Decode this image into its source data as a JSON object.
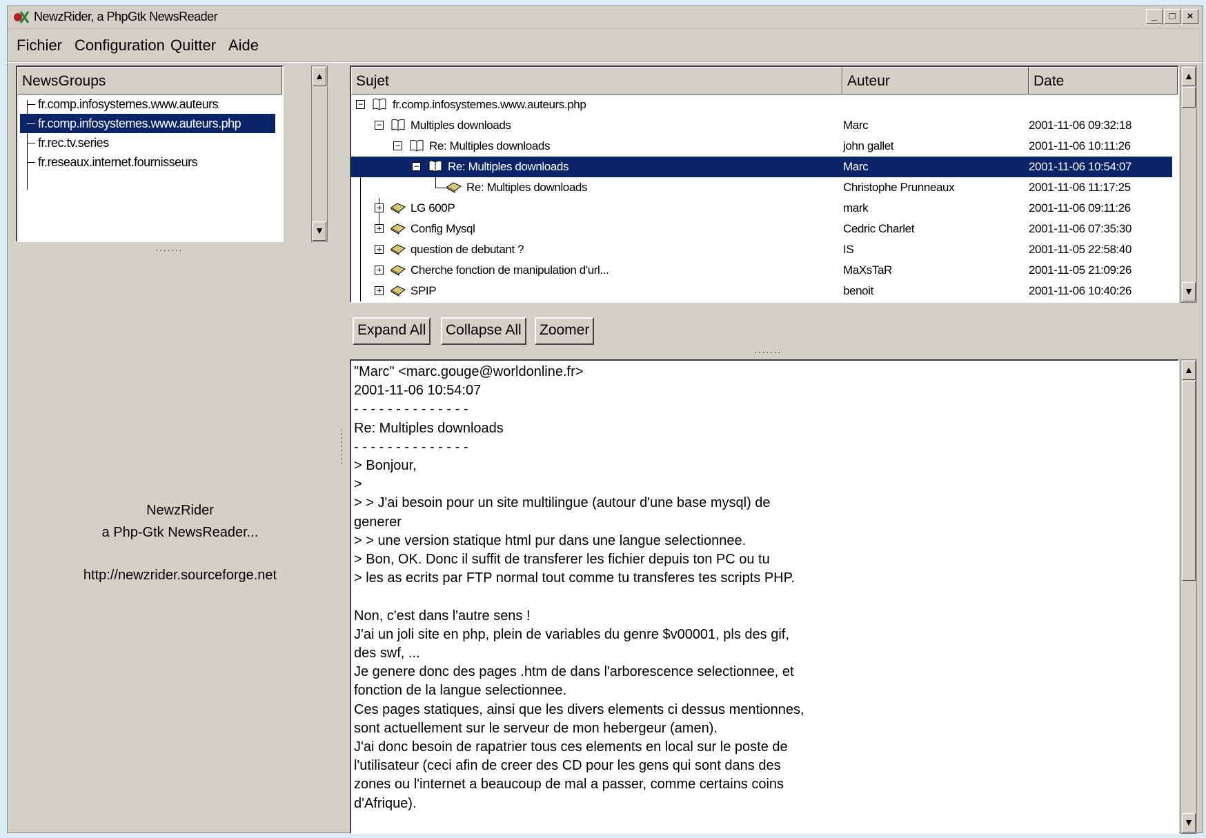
{
  "window": {
    "title": "NewzRider, a PhpGtk NewsReader",
    "minimize": "_",
    "maximize": "□",
    "close": "×"
  },
  "menu": [
    "Fichier",
    "Configuration",
    "Quitter",
    "Aide"
  ],
  "newsgroups": {
    "header": "NewsGroups",
    "items": [
      {
        "label": "fr.comp.infosystemes.www.auteurs",
        "selected": false
      },
      {
        "label": "fr.comp.infosystemes.www.auteurs.php",
        "selected": true
      },
      {
        "label": "fr.rec.tv.series",
        "selected": false
      },
      {
        "label": "fr.reseaux.internet.fournisseurs",
        "selected": false
      }
    ]
  },
  "about": {
    "line1": "NewzRider",
    "line2": "a Php-Gtk NewsReader...",
    "line3": "http://newzrider.sourceforge.net"
  },
  "threads": {
    "headers": {
      "subject": "Sujet",
      "author": "Auteur",
      "date": "Date"
    },
    "rows": [
      {
        "subject": "fr.comp.infosystemes.www.auteurs.php",
        "author": "",
        "date": "",
        "level": 0,
        "expander": "−",
        "icon": "book-icon",
        "selected": false
      },
      {
        "subject": "Multiples downloads",
        "author": "Marc",
        "date": "2001-11-06 09:32:18",
        "level": 1,
        "expander": "−",
        "icon": "book-icon",
        "selected": false
      },
      {
        "subject": "Re: Multiples downloads",
        "author": "john gallet",
        "date": "2001-11-06 10:11:26",
        "level": 2,
        "expander": "−",
        "icon": "book-icon",
        "selected": false
      },
      {
        "subject": "Re: Multiples downloads",
        "author": "Marc",
        "date": "2001-11-06 10:54:07",
        "level": 3,
        "expander": "−",
        "icon": "book-icon",
        "selected": true
      },
      {
        "subject": "Re: Multiples downloads",
        "author": "Christophe Prunneaux",
        "date": "2001-11-06 11:17:25",
        "level": 4,
        "expander": "",
        "icon": "closed-book-icon",
        "selected": false
      },
      {
        "subject": "LG 600P",
        "author": "mark",
        "date": "2001-11-06 09:11:26",
        "level": 1,
        "expander": "+",
        "icon": "closed-book-icon",
        "selected": false
      },
      {
        "subject": "Config Mysql",
        "author": "Cedric Charlet",
        "date": "2001-11-06 07:35:30",
        "level": 1,
        "expander": "+",
        "icon": "closed-book-icon",
        "selected": false
      },
      {
        "subject": "question de debutant ?",
        "author": "IS",
        "date": "2001-11-05 22:58:40",
        "level": 1,
        "expander": "+",
        "icon": "closed-book-icon",
        "selected": false
      },
      {
        "subject": "Cherche fonction de manipulation d'url...",
        "author": "MaXsTaR",
        "date": "2001-11-05 21:09:26",
        "level": 1,
        "expander": "+",
        "icon": "closed-book-icon",
        "selected": false
      },
      {
        "subject": "SPIP",
        "author": "benoit",
        "date": "2001-11-06 10:40:26",
        "level": 1,
        "expander": "+",
        "icon": "closed-book-icon",
        "selected": false
      }
    ]
  },
  "buttons": {
    "expand_all": "Expand All",
    "collapse_all": "Collapse All",
    "zoomer": "Zoomer"
  },
  "message": {
    "lines": [
      "\"Marc\" <marc.gouge@worldonline.fr>",
      "2001-11-06 10:54:07",
      "- - - - - - - - - - - - - -",
      "Re: Multiples downloads",
      "- - - - - - - - - - - - - -",
      "> Bonjour,",
      ">",
      "> > J'ai besoin pour un site multilingue (autour d'une base mysql) de",
      "generer",
      "> > une version statique html pur dans une langue selectionnee.",
      "> Bon, OK. Donc il suffit de transferer les fichier depuis ton PC ou tu",
      "> les as ecrits par FTP normal tout comme tu transferes tes scripts PHP.",
      "",
      "Non, c'est dans l'autre sens !",
      "J'ai un joli site en php, plein de variables du genre $v00001, pls des gif,",
      "des swf, ...",
      "Je genere donc des pages .htm de dans l'arborescence selectionnee, et",
      "fonction de la langue selectionnee.",
      "Ces pages statiques, ainsi que les divers elements ci dessus mentionnes,",
      "sont actuellement sur le serveur de mon hebergeur (amen).",
      "J'ai donc besoin de rapatrier tous ces elements en local sur le poste de",
      "l'utilisateur (ceci afin de creer des CD pour les gens qui sont dans des",
      "zones ou l'internet a beaucoup de mal a passer, comme certains coins",
      "d'Afrique)."
    ]
  },
  "colors": {
    "selection": "#0a246a",
    "chrome": "#d4d0c8",
    "desktop": "#dcecf4"
  }
}
